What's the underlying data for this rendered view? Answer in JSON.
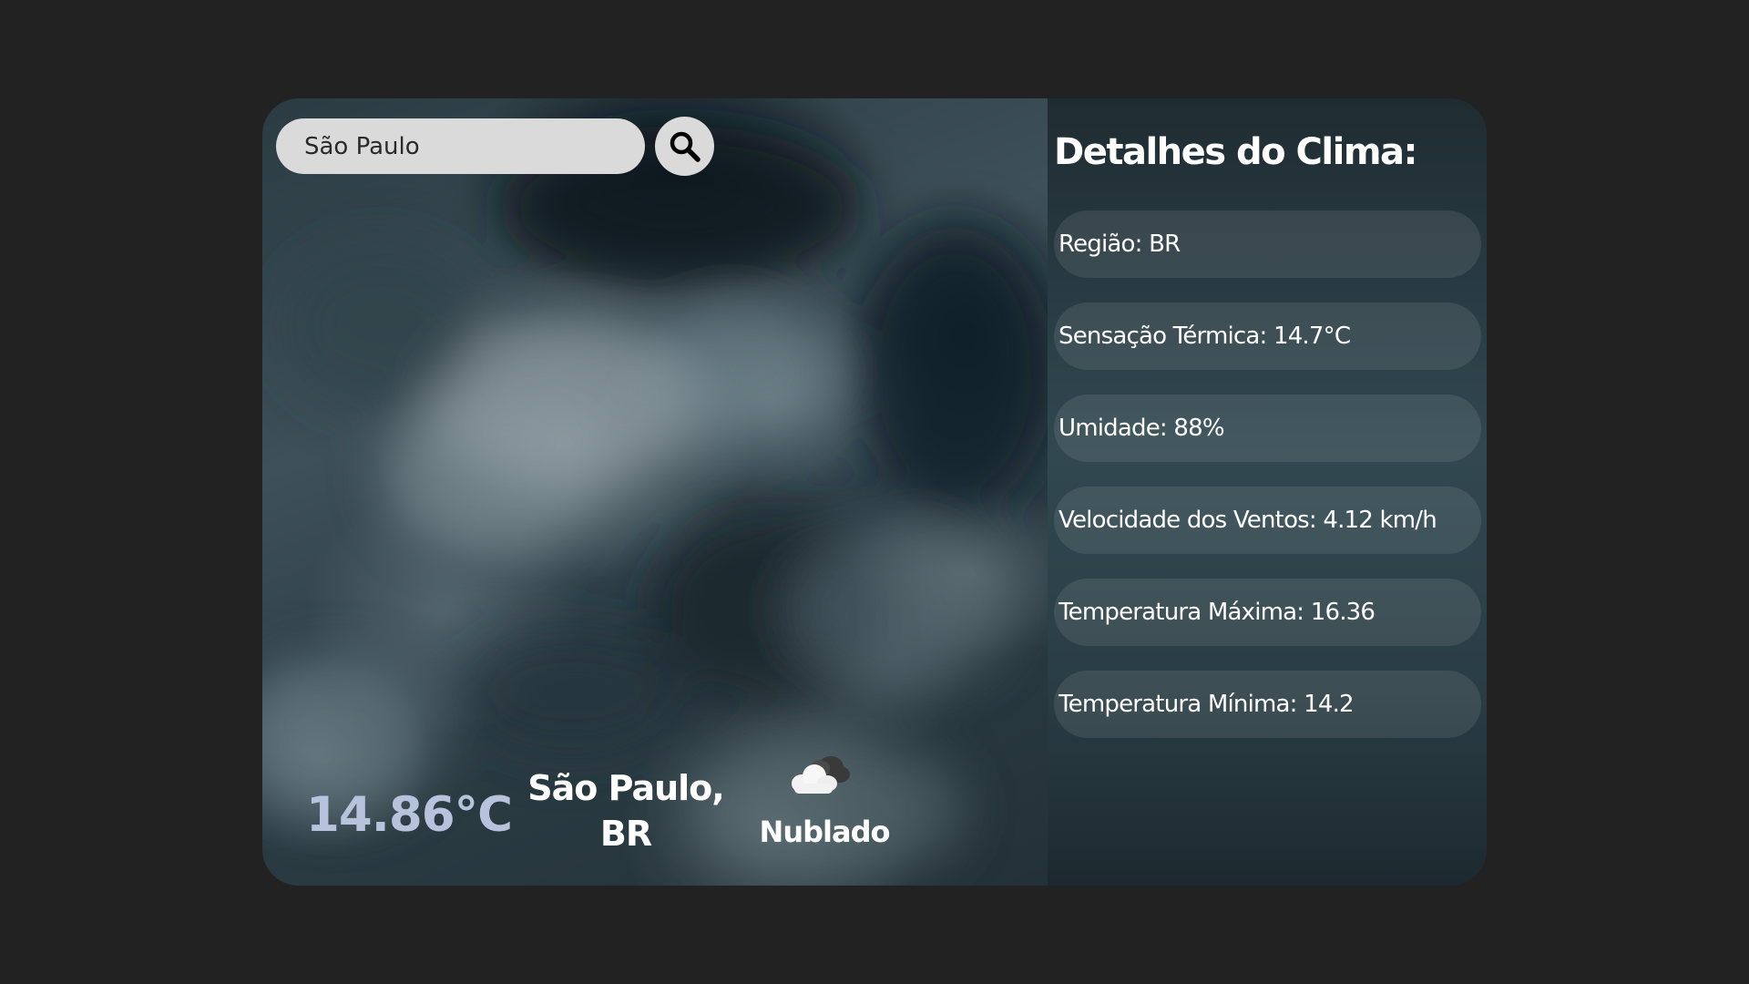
{
  "search": {
    "value": "São Paulo",
    "button_icon": "search-icon"
  },
  "current": {
    "temperature": "14.86°C",
    "city_line1": "São Paulo,",
    "city_line2": "BR",
    "condition_icon": "cloud-icon",
    "condition": "Nublado"
  },
  "details": {
    "title": "Detalhes do Clima:",
    "items": [
      {
        "label": "Região: BR"
      },
      {
        "label": "Sensação Térmica: 14.7°C"
      },
      {
        "label": "Umidade: 88%"
      },
      {
        "label": "Velocidade dos Ventos: 4.12 km/h"
      },
      {
        "label": "Temperatura Máxima: 16.36"
      },
      {
        "label": "Temperatura Mínima: 14.2"
      }
    ]
  },
  "colors": {
    "page_background": "#222222",
    "temperature_text": "#b7c3dc",
    "search_background": "#dadada"
  }
}
